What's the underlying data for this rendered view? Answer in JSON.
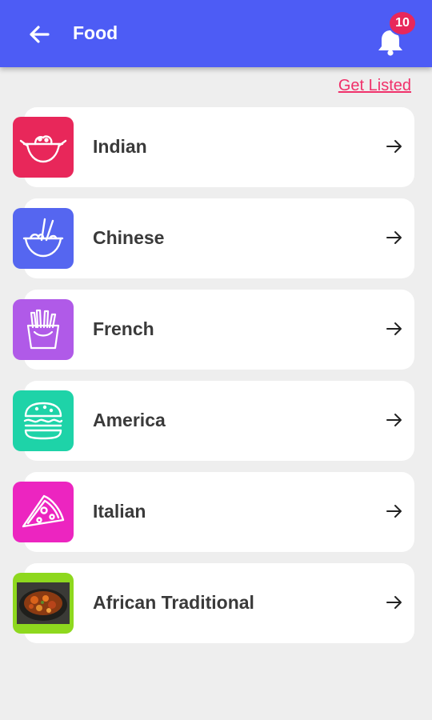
{
  "header": {
    "title": "Food",
    "notification_count": "10",
    "bar_color": "#4d5cf5",
    "badge_color": "#e8275a"
  },
  "get_listed": "Get Listed",
  "categories": [
    {
      "label": "Indian",
      "icon": "wok-icon",
      "color": "#e8275a"
    },
    {
      "label": "Chinese",
      "icon": "noodle-bowl-icon",
      "color": "#5566f0"
    },
    {
      "label": "French",
      "icon": "fries-icon",
      "color": "#b05ae8"
    },
    {
      "label": "America",
      "icon": "burger-icon",
      "color": "#1ed3a8"
    },
    {
      "label": "Italian",
      "icon": "pizza-slice-icon",
      "color": "#ec25c0"
    },
    {
      "label": "African Traditional",
      "icon": "stew-pot-photo",
      "color": "#8ed81e"
    }
  ]
}
